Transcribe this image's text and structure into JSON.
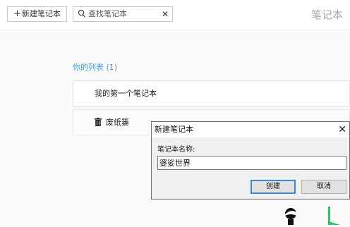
{
  "toolbar": {
    "new_notebook_label": "新建笔记本",
    "new_notebook_icon": "plus-icon",
    "search_text": "查找笔记本",
    "search_icon": "search-icon",
    "clear_icon": "close-icon"
  },
  "page_title": "笔记本",
  "list": {
    "header": "你的列表 (1)",
    "items": [
      {
        "label": "我的第一个笔记本"
      }
    ],
    "trash": {
      "label": "废纸篓",
      "icon": "trash-icon"
    }
  },
  "dialog": {
    "title": "新建笔记本",
    "field_label": "笔记本名称:",
    "field_value": "婆娑世界",
    "create_label": "创建",
    "cancel_label": "取消",
    "close_icon": "close-icon"
  },
  "colors": {
    "accent": "#3b9ae1",
    "primary_button_border": "#3c8ad8",
    "figure_green": "#2ec466"
  }
}
